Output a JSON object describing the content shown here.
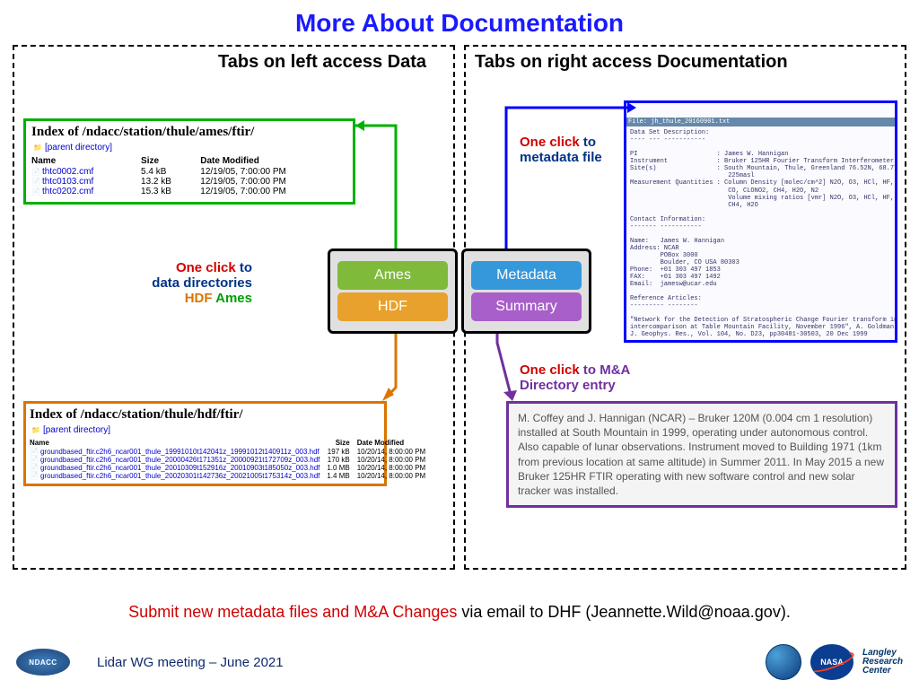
{
  "title": "More About Documentation",
  "left": {
    "heading": "Tabs on left access Data",
    "ames": {
      "title": "Index of /ndacc/station/thule/ames/ftir/",
      "parent": "[parent directory]",
      "cols": {
        "name": "Name",
        "size": "Size",
        "date": "Date Modified"
      },
      "rows": [
        {
          "name": "thtc0002.cmf",
          "size": "5.4 kB",
          "date": "12/19/05, 7:00:00 PM"
        },
        {
          "name": "thtc0103.cmf",
          "size": "13.2 kB",
          "date": "12/19/05, 7:00:00 PM"
        },
        {
          "name": "thtc0202.cmf",
          "size": "15.3 kB",
          "date": "12/19/05, 7:00:00 PM"
        }
      ]
    },
    "anno": {
      "l1a": "One click",
      "l1b": " to",
      "l2": "data directories",
      "l3a": "HDF",
      "l3b": "  Ames"
    },
    "hdf": {
      "title": "Index of /ndacc/station/thule/hdf/ftir/",
      "parent": "[parent directory]",
      "cols": {
        "name": "Name",
        "size": "Size",
        "date": "Date Modified"
      },
      "rows": [
        {
          "name": "groundbased_ftir.c2h6_ncar001_thule_19991010t142041z_19991012t140911z_003.hdf",
          "size": "197 kB",
          "date": "10/20/14, 8:00:00 PM"
        },
        {
          "name": "groundbased_ftir.c2h6_ncar001_thule_20000426t171351z_20000921t172709z_003.hdf",
          "size": "170 kB",
          "date": "10/20/14, 8:00:00 PM"
        },
        {
          "name": "groundbased_ftir.c2h6_ncar001_thule_20010309t152916z_20010903t185050z_003.hdf",
          "size": "1.0 MB",
          "date": "10/20/14, 8:00:00 PM"
        },
        {
          "name": "groundbased_ftir.c2h6_ncar001_thule_20020301t142736z_20021005t175314z_003.hdf",
          "size": "1.4 MB",
          "date": "10/20/14, 8:00:00 PM"
        }
      ]
    },
    "btns": {
      "ames": "Ames",
      "hdf": "HDF"
    }
  },
  "right": {
    "heading": "Tabs on right access Documentation",
    "btns": {
      "meta": "Metadata",
      "summ": "Summary"
    },
    "anno1": {
      "a": "One click",
      "b": " to",
      "c": "metadata file"
    },
    "anno2": {
      "a": "One click",
      "b": " to M&A",
      "c": "Directory entry"
    },
    "meta": {
      "file": "File: jh_thule_20160901.txt",
      "body": "Data Set Description:\n---- --- -----------\n\nPI                     : James W. Hannigan\nInstrument             : Bruker 125HR Fourier Transform Interferometer\nSite(s)                : South Mountain, Thule, Greenland 76.52N, 68.77W,\n                          225masl\nMeasurement Quantities : Column Density [molec/cm^2] N2O, O3, HCl, HF, HNO3,\n                          CO, CLONO2, CH4, H2O, N2\n                          Volume mixing ratios [vmr] N2O, O3, HCl, HF, HNO3, CO,\n                          CH4, H2O\n\nContact Information:\n------- -----------\n\nName:   James W. Hannigan\nAddress: NCAR\n        POBox 3000\n        Boulder, CO USA 80303\nPhone:  +01 303 497 1853\nFAX:    +01 303 497 1492\nEmail:  jamesw@ucar.edu\n\nReference Articles:\n--------- --------\n\n\"Network for the Detection of Stratospheric Change Fourier transform infrared\nintercomparison at Table Mountain Facility, November 1996\", A. Goldman et.al.,\nJ. Geophys. Res., Vol. 104, No. D23, pp30481-30503, 20 Dec 1999"
    },
    "summary": "M. Coffey and J. Hannigan (NCAR) – Bruker 120M (0.004 cm 1 resolution) installed at South Mountain in 1999, operating under autonomous control.  Also capable of lunar observations.  Instrument moved to Building 1971 (1km from previous location at same altitude) in Summer 2011.  In May 2015 a new Bruker 125HR FTIR operating with new software control and new solar tracker was installed."
  },
  "submit": {
    "a": "Submit new metadata files and M&A Changes",
    "b": " via email to DHF (Jeannette.Wild@noaa.gov)."
  },
  "footer": {
    "text": "Lidar WG meeting – June 2021",
    "ndacc": "NDACC",
    "nasa": "NASA",
    "larc1": "Langley",
    "larc2": "Research",
    "larc3": "Center"
  }
}
